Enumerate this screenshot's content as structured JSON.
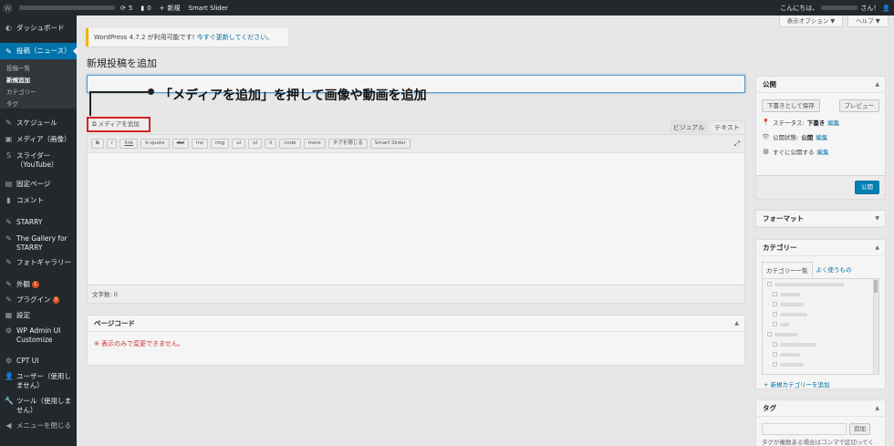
{
  "adminbar": {
    "update_count": "5",
    "comment_count": "0",
    "new_label": "新規",
    "smart_slider": "Smart Slider",
    "greeting": "こんにちは、",
    "greeting_suffix": "さん！"
  },
  "sidebar": {
    "items": [
      {
        "icon": "dashboard-icon",
        "label": "ダッシュボード"
      },
      {
        "icon": "pin-icon",
        "label": "投稿（ニュース）"
      },
      {
        "icon": "schedule-icon",
        "label": "スケジュール"
      },
      {
        "icon": "media-icon",
        "label": "メディア（画像）"
      },
      {
        "icon": "slider-icon",
        "label": "スライダー（YouTube）"
      },
      {
        "icon": "page-icon",
        "label": "固定ページ"
      },
      {
        "icon": "comment-icon",
        "label": "コメント"
      },
      {
        "icon": "starry-icon",
        "label": "STARRY"
      },
      {
        "icon": "gallery-icon",
        "label": "The Gallery for STARRY"
      },
      {
        "icon": "photo-icon",
        "label": "フォトギャラリー"
      },
      {
        "icon": "appearance-icon",
        "label": "外観",
        "badge": "1"
      },
      {
        "icon": "plugin-icon",
        "label": "プラグイン",
        "badge": "3"
      },
      {
        "icon": "settings-icon",
        "label": "設定"
      },
      {
        "icon": "gear-icon",
        "label": "WP Admin UI Customize"
      },
      {
        "icon": "cpt-icon",
        "label": "CPT UI"
      },
      {
        "icon": "user-icon",
        "label": "ユーザー（使用しません）"
      },
      {
        "icon": "tools-icon",
        "label": "ツール（使用しません）"
      },
      {
        "icon": "collapse-icon",
        "label": "メニューを閉じる"
      }
    ],
    "submenu": [
      "投稿一覧",
      "新規追加",
      "カテゴリー",
      "タグ"
    ]
  },
  "screen_options": "表示オプション ▼",
  "help": "ヘルプ ▼",
  "notice": {
    "text": "WordPress 4.7.2 が利用可能です! ",
    "link": "今すぐ更新してください。"
  },
  "page_title": "新規投稿を追加",
  "callout": "「メディアを追加」を押して画像や動画を追加",
  "editor": {
    "media_button": "メディアを追加",
    "tab_visual": "ビジュアル",
    "tab_text": "テキスト",
    "quicktags": [
      "b",
      "i",
      "link",
      "b-quote",
      "del",
      "ins",
      "img",
      "ul",
      "ol",
      "li",
      "code",
      "more",
      "タグを閉じる",
      "Smart Slider"
    ],
    "word_count": "文字数: 0"
  },
  "page_code": {
    "title": "ページコード",
    "warning": "※ 表示のみで変更できません。"
  },
  "publish": {
    "title": "公開",
    "save_draft": "下書きとして保存",
    "preview": "プレビュー",
    "status_label": "ステータス: ",
    "status_value": "下書き",
    "visibility_label": "公開状態: ",
    "visibility_value": "公開",
    "schedule_label": "すぐに公開する",
    "edit": "編集",
    "publish_button": "公開"
  },
  "format": {
    "title": "フォーマット"
  },
  "category": {
    "title": "カテゴリー",
    "tab_all": "カテゴリー一覧",
    "tab_popular": "よく使うもの",
    "add_new": "+ 新規カテゴリーを追加"
  },
  "tags": {
    "title": "タグ",
    "add": "追加",
    "help": "タグが複数ある場合はコンマで区切ってください"
  }
}
